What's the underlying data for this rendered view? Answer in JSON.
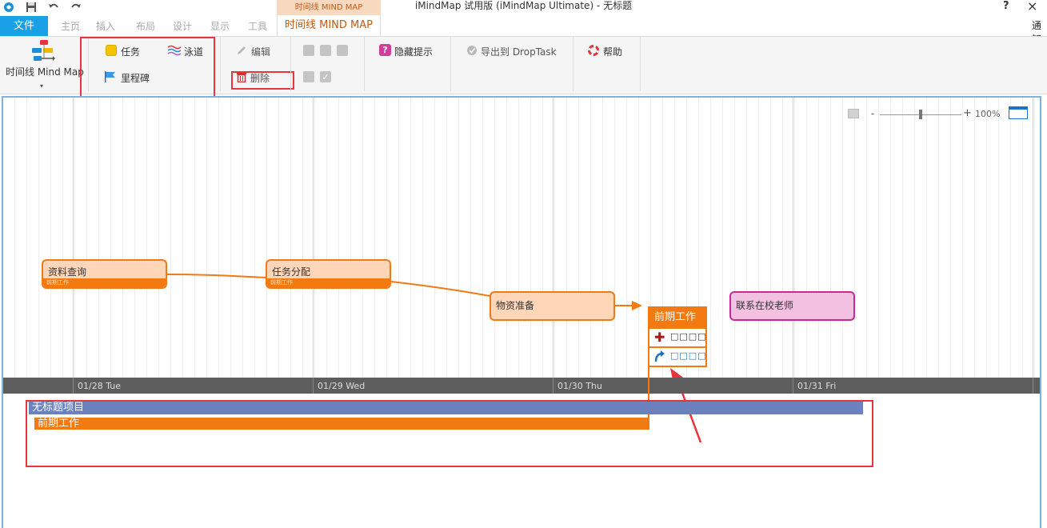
{
  "window": {
    "title": "iMindMap 试用版 (iMindMap Ultimate) - 无标题",
    "help": "?",
    "close": "×"
  },
  "quick_access": {
    "icons": [
      "app-logo-icon",
      "save-icon",
      "undo-icon",
      "redo-icon"
    ]
  },
  "tabs": {
    "context_header": "时间线 MIND MAP",
    "file": "文件",
    "items": [
      "主页",
      "插入",
      "布局",
      "设计",
      "显示",
      "工具"
    ],
    "active": "时间线 MIND MAP",
    "right_text": "通知"
  },
  "ribbon": {
    "timeline_mindmap": "时间线 Mind Map",
    "task": "任务",
    "swimlane": "泳道",
    "milestone": "里程碑",
    "edit": "编辑",
    "delete": "删除",
    "hide_tips": "隐藏提示",
    "export_droptask": "导出到 DropTask",
    "help": "帮助"
  },
  "zoom": {
    "minus": "-",
    "plus": "+",
    "percent": "100%",
    "level": 0.5
  },
  "timeline": {
    "dates": [
      "01/28 Tue",
      "01/29 Wed",
      "01/30 Thu",
      "01/31 Fri"
    ]
  },
  "tasks": [
    {
      "title": "资料查询",
      "tag": "前期工作"
    },
    {
      "title": "任务分配",
      "tag": "前期工作"
    },
    {
      "title": "物资准备"
    },
    {
      "title": "联系在校老师"
    }
  ],
  "popup": {
    "title": "前期工作",
    "row1": "□□□□",
    "row2": "□□□□"
  },
  "gantt": {
    "project": "无标题项目",
    "task": "前期工作"
  },
  "colors": {
    "accent_orange": "#f27a10",
    "file_tab_blue": "#1aa0e6",
    "annotation_red": "#e8343a",
    "project_bar": "#6b82be",
    "pink_card": "#f2c0e0"
  }
}
